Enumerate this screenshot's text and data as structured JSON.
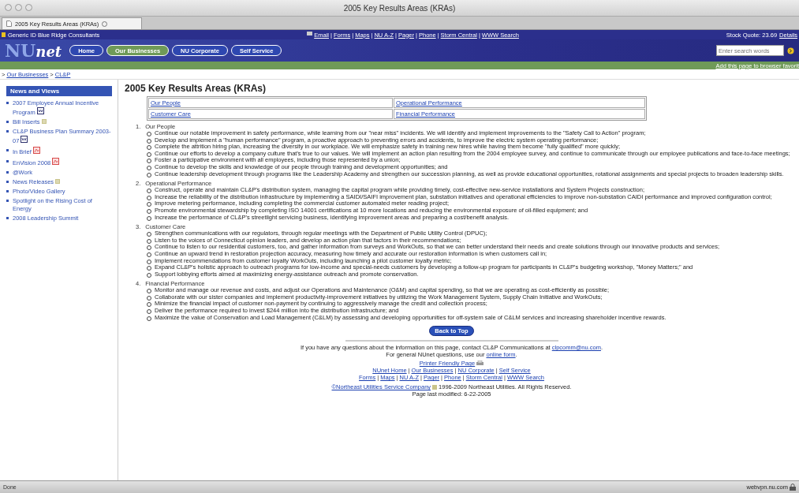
{
  "window": {
    "title": "2005 Key Results Areas (KRAs)"
  },
  "tab": {
    "label": "2005 Key Results Areas (KRAs)"
  },
  "top_bar": {
    "user": "Generic ID Blue Ridge Consultants",
    "separator": "|",
    "links": [
      "Email",
      "Forms",
      "Maps",
      "NU A-Z",
      "Pager",
      "Phone",
      "Storm Central",
      "WWW Search"
    ],
    "stock_quote": "Stock Quote: 23.69",
    "details": "Details"
  },
  "nav": {
    "logo_main": "NU",
    "logo_tail": "net",
    "buttons": [
      {
        "label": "Home",
        "selected": false
      },
      {
        "label": "Our Businesses",
        "selected": true
      },
      {
        "label": "NU Corporate",
        "selected": false
      },
      {
        "label": "Self Service",
        "selected": false
      }
    ],
    "search": {
      "placeholder": "Enter search words"
    },
    "favorites": "Add this page to browser favorit"
  },
  "breadcrumb": [
    {
      "marker": ">",
      "label": "Our Businesses"
    },
    {
      "marker": ">",
      "label": "CL&P"
    }
  ],
  "sidebar": {
    "heading": "News and Views",
    "items": [
      {
        "label": "2007 Employee Annual Incentive Program",
        "kind": "word"
      },
      {
        "label": "Bill Inserts",
        "kind": "file"
      },
      {
        "label": "CL&P Business Plan Summary 2003-07",
        "kind": "word"
      },
      {
        "label": "In Brief",
        "kind": "pdf"
      },
      {
        "label": "EnVision 2008",
        "kind": "pdf"
      },
      {
        "label": "@Work",
        "kind": "plain"
      },
      {
        "label": "News Releases",
        "kind": "file"
      },
      {
        "label": "Photo/Video Gallery",
        "kind": "plain"
      },
      {
        "label": "Spotlight on the Rising Cost of Energy",
        "kind": "plain"
      },
      {
        "label": "2008 Leadership Summit",
        "kind": "plain"
      }
    ]
  },
  "main": {
    "title": "2005 Key Results Areas (KRAs)",
    "table": [
      [
        "Our People",
        "Operational Performance"
      ],
      [
        "Customer Care",
        "Financial Performance"
      ]
    ],
    "sections": [
      {
        "number": "1.",
        "heading": "Our People",
        "items": [
          "Continue our notable improvement in safety performance, while learning from our \"near miss\" incidents. We will identify and implement improvements to the \"Safety Call to Action\" program;",
          "Develop and implement a \"human performance\" program, a proactive approach to preventing errors and accidents, to improve the electric system operating performance;",
          "Complete the attrition hiring plan, increasing the diversity in our workplace. We will emphasize safety in training new hires while having them become \"fully qualified\" more quickly;",
          "Continue our efforts to develop a company culture that's true to our values. We will implement an action plan resulting from the 2004 employee survey, and continue to communicate through our employee publications and face-to-face meetings;",
          "Foster a participative environment with all employees, including those represented by a union;",
          "Continue to develop the skills and knowledge of our people through training and development opportunities; and",
          "Continue leadership development through programs like the Leadership Academy and strengthen our succession planning, as well as provide educational opportunities, rotational assignments and special projects to broaden leadership skills."
        ]
      },
      {
        "number": "2.",
        "heading": "Operational Performance",
        "items": [
          "Construct, operate and maintain CL&P's distribution system, managing the capital program while providing timely, cost-effective new-service installations and System Projects construction;",
          "Increase the reliability of the distribution infrastructure by implementing a SAIDI/SAIFI improvement plan, substation initiatives and operational efficiencies to improve non-substation CAIDI performance and improved configuration control;",
          "Improve metering performance, including completing the commercial customer automated meter reading project;",
          "Promote environmental stewardship by completing ISO 14001 certifications at 10 more locations and reducing the environmental exposure of oil-filled equipment; and",
          "Increase the performance of CL&P's streetlight servicing business, identifying improvement areas and preparing a cost/benefit analysis."
        ]
      },
      {
        "number": "3.",
        "heading": "Customer Care",
        "items": [
          "Strengthen communications with our regulators, through regular meetings with the Department of Public Utility Control (DPUC);",
          "Listen to the voices of Connecticut opinion leaders, and develop an action plan that factors in their recommendations;",
          "Continue to listen to our residential customers, too, and gather information from surveys and WorkOuts, so that we can better understand their needs and create solutions through our innovative products and services;",
          "Continue an upward trend in restoration projection accuracy, measuring how timely and accurate our restoration information is when customers call in;",
          "Implement recommendations from customer loyalty WorkOuts, including launching a pilot customer loyalty metric;",
          "Expand CL&P's holistic approach to outreach programs for low-income and special-needs customers by developing a follow-up program for participants in CL&P's budgeting workshop, \"Money Matters;\" and",
          "Support lobbying efforts aimed at maximizing energy-assistance outreach and promote conservation."
        ]
      },
      {
        "number": "4.",
        "heading": "Financial Performance",
        "items": [
          "Monitor and manage our revenue and costs, and adjust our Operations and Maintenance (O&M) and capital spending, so that we are operating as cost-efficiently as possible;",
          "Collaborate with our sister companies and implement productivity-improvement initiatives by utilizing the Work Management System, Supply Chain Initiative and WorkOuts;",
          "Minimize the financial impact of customer non-payment by continuing to aggressively manage the credit and collection process;",
          "Deliver the performance required to invest $244 million into the distribution infrastructure; and",
          "Maximize the value of Conservation and Load Management (C&LM) by assessing and developing opportunities for off-system sale of C&LM services and increasing shareholder incentive rewards."
        ]
      }
    ],
    "back_to_top": "Back to Top"
  },
  "footer": {
    "contact": {
      "before": "If you have any questions about the information on this page, contact CL&P Communications at ",
      "link": "clpcomm@nu.com",
      "after": "."
    },
    "general": {
      "before": "For general NUnet questions, use our ",
      "link": "online form",
      "after": "."
    },
    "printer": "Printer Friendly Page",
    "separator": "|",
    "links_1": [
      "NUnet Home",
      "Our Businesses",
      "NU Corporate",
      "Self Service"
    ],
    "links_2": [
      "Forms",
      "Maps",
      "NU A-Z",
      "Pager",
      "Phone",
      "Storm Central",
      "WWW Search"
    ],
    "copyright_link": "©Northeast Utilities Service Company",
    "copyright_text": "1996-2009 Northeast Utilities. All Rights Reserved.",
    "modified": "Page last modified: 6-22-2005"
  },
  "status_bar": {
    "text": "Done",
    "host": "webvpn.nu.com"
  }
}
